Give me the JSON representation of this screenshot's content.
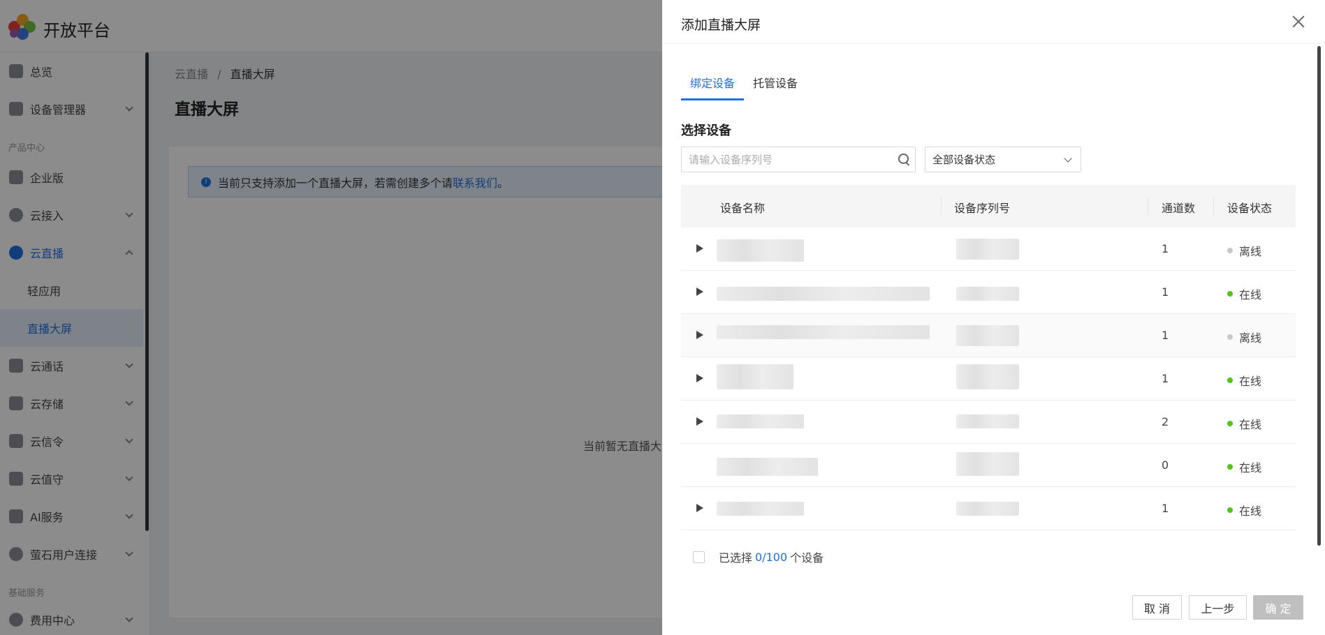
{
  "app": {
    "brand": "开放平台",
    "sidebar": {
      "items": [
        {
          "label": "总览"
        },
        {
          "label": "设备管理器"
        },
        {
          "label": "企业版"
        },
        {
          "label": "云接入"
        },
        {
          "label": "云直播"
        },
        {
          "label": "轻应用"
        },
        {
          "label": "直播大屏"
        },
        {
          "label": "云通话"
        },
        {
          "label": "云存储"
        },
        {
          "label": "云信令"
        },
        {
          "label": "云值守"
        },
        {
          "label": "AI服务"
        },
        {
          "label": "萤石用户连接"
        },
        {
          "label": "费用中心"
        }
      ],
      "groups": [
        "产品中心",
        "基础服务"
      ]
    },
    "breadcrumb": {
      "parent": "云直播",
      "separator": "/",
      "current": "直播大屏"
    },
    "page_title": "直播大屏",
    "notice": {
      "icon": "!",
      "text": "当前只支持添加一个直播大屏，若需创建多个请",
      "link": "联系我们",
      "end": "。"
    },
    "empty_text": "当前暂无直播大屏"
  },
  "drawer": {
    "title": "添加直播大屏",
    "tabs": [
      "绑定设备",
      "托管设备"
    ],
    "section_title": "选择设备",
    "search": {
      "placeholder": "请输入设备序列号",
      "value": ""
    },
    "status_select": {
      "selected": "全部设备状态"
    },
    "table": {
      "headers": {
        "name": "设备名称",
        "serial": "设备序列号",
        "channels": "通道数",
        "status": "设备状态"
      },
      "rows": [
        {
          "channels": "1",
          "status": "离线",
          "expandable": true
        },
        {
          "channels": "1",
          "status": "在线",
          "expandable": true
        },
        {
          "channels": "1",
          "status": "离线",
          "expandable": true
        },
        {
          "channels": "1",
          "status": "在线",
          "expandable": true
        },
        {
          "channels": "2",
          "status": "在线",
          "expandable": true
        },
        {
          "channels": "0",
          "status": "在线",
          "expandable": false
        },
        {
          "channels": "1",
          "status": "在线",
          "expandable": true
        }
      ]
    },
    "selection": {
      "prefix": "已选择",
      "count": "0/100",
      "suffix": "个设备"
    },
    "buttons": {
      "cancel": "取 消",
      "prev": "上一步",
      "confirm": "确 定"
    }
  },
  "colors": {
    "accent": "#1f6fe0",
    "online": "#52c41a",
    "offline": "#c8c8c8"
  }
}
